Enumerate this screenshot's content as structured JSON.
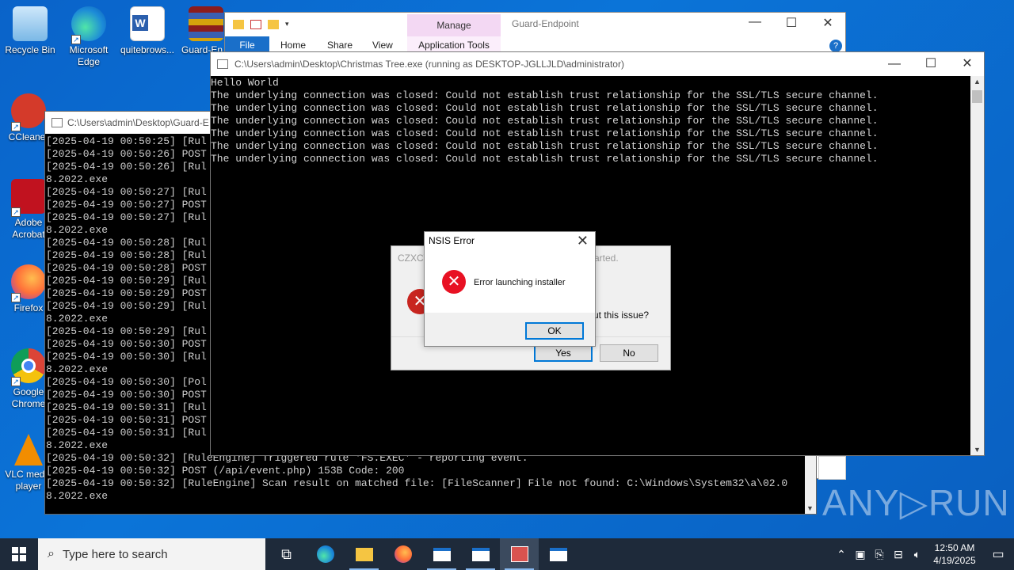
{
  "desktop": {
    "icons": [
      {
        "label": "Recycle Bin",
        "color": "#9ad0f5"
      },
      {
        "label": "Microsoft Edge",
        "color": "#2a9be0"
      },
      {
        "label": "quitebrows...",
        "color": "#2b5fad"
      },
      {
        "label": "Guard-En...",
        "color": "#8b1c1c"
      },
      {
        "label": "CCleaner",
        "color": "#c33"
      },
      {
        "label": "Adobe Acrobat",
        "color": "#c1121f"
      },
      {
        "label": "Firefox",
        "color": "#ff7139"
      },
      {
        "label": "Google Chrome",
        "color": "#e9b000"
      },
      {
        "label": "VLC media player",
        "color": "#f28d00"
      }
    ]
  },
  "explorer": {
    "manage_label": "Manage",
    "title": "Guard-Endpoint",
    "tabs": [
      "File",
      "Home",
      "Share",
      "View"
    ],
    "app_tools": "Application Tools"
  },
  "guard_console": {
    "title": "C:\\Users\\admin\\Desktop\\Guard-E",
    "lines": [
      "[2025-04-19 00:50:25] [Rul",
      "[2025-04-19 00:50:26] POST",
      "[2025-04-19 00:50:26] [Rul",
      "8.2022.exe",
      "[2025-04-19 00:50:27] [Rul",
      "[2025-04-19 00:50:27] POST",
      "[2025-04-19 00:50:27] [Rul",
      "8.2022.exe",
      "[2025-04-19 00:50:28] [Rul",
      "[2025-04-19 00:50:28] [Rul",
      "[2025-04-19 00:50:28] POST",
      "[2025-04-19 00:50:29] [Rul",
      "[2025-04-19 00:50:29] POST",
      "[2025-04-19 00:50:29] [Rul",
      "8.2022.exe",
      "[2025-04-19 00:50:29] [Rul",
      "[2025-04-19 00:50:30] POST",
      "[2025-04-19 00:50:30] [Rul",
      "8.2022.exe",
      "[2025-04-19 00:50:30] [Pol",
      "[2025-04-19 00:50:30] POST",
      "[2025-04-19 00:50:31] [Rul",
      "[2025-04-19 00:50:31] POST",
      "[2025-04-19 00:50:31] [Rul",
      "8.2022.exe",
      "[2025-04-19 00:50:32] [RuleEngine] Triggered rule 'FS.EXEC' - reporting event.",
      "[2025-04-19 00:50:32] POST (/api/event.php) 153B Code: 200",
      "[2025-04-19 00:50:32] [RuleEngine] Scan result on matched file: [FileScanner] File not found: C:\\Windows\\System32\\a\\02.0",
      "8.2022.exe"
    ]
  },
  "xmas_console": {
    "title": "C:\\Users\\admin\\Desktop\\Christmas Tree.exe (running as DESKTOP-JGLLJLD\\administrator)",
    "lines": [
      "Hello World",
      "The underlying connection was closed: Could not establish trust relationship for the SSL/TLS secure channel.",
      "The underlying connection was closed: Could not establish trust relationship for the SSL/TLS secure channel.",
      "The underlying connection was closed: Could not establish trust relationship for the SSL/TLS secure channel.",
      "The underlying connection was closed: Could not establish trust relationship for the SSL/TLS secure channel.",
      "The underlying connection was closed: Could not establish trust relationship for the SSL/TLS secure channel.",
      "The underlying connection was closed: Could not establish trust relationship for the SSL/TLS secure channel."
    ]
  },
  "back_dialog": {
    "title": "CZXCV",
    "fragment_top": "arted.",
    "fragment_question": "ut this issue?",
    "yes_label": "Yes",
    "no_label": "No"
  },
  "nsis_dialog": {
    "title": "NSIS Error",
    "message": "Error launching installer",
    "ok_label": "OK"
  },
  "watermark": "ANY▷RUN",
  "taskbar": {
    "search_placeholder": "Type here to search",
    "time": "12:50 AM",
    "date": "4/19/2025"
  }
}
